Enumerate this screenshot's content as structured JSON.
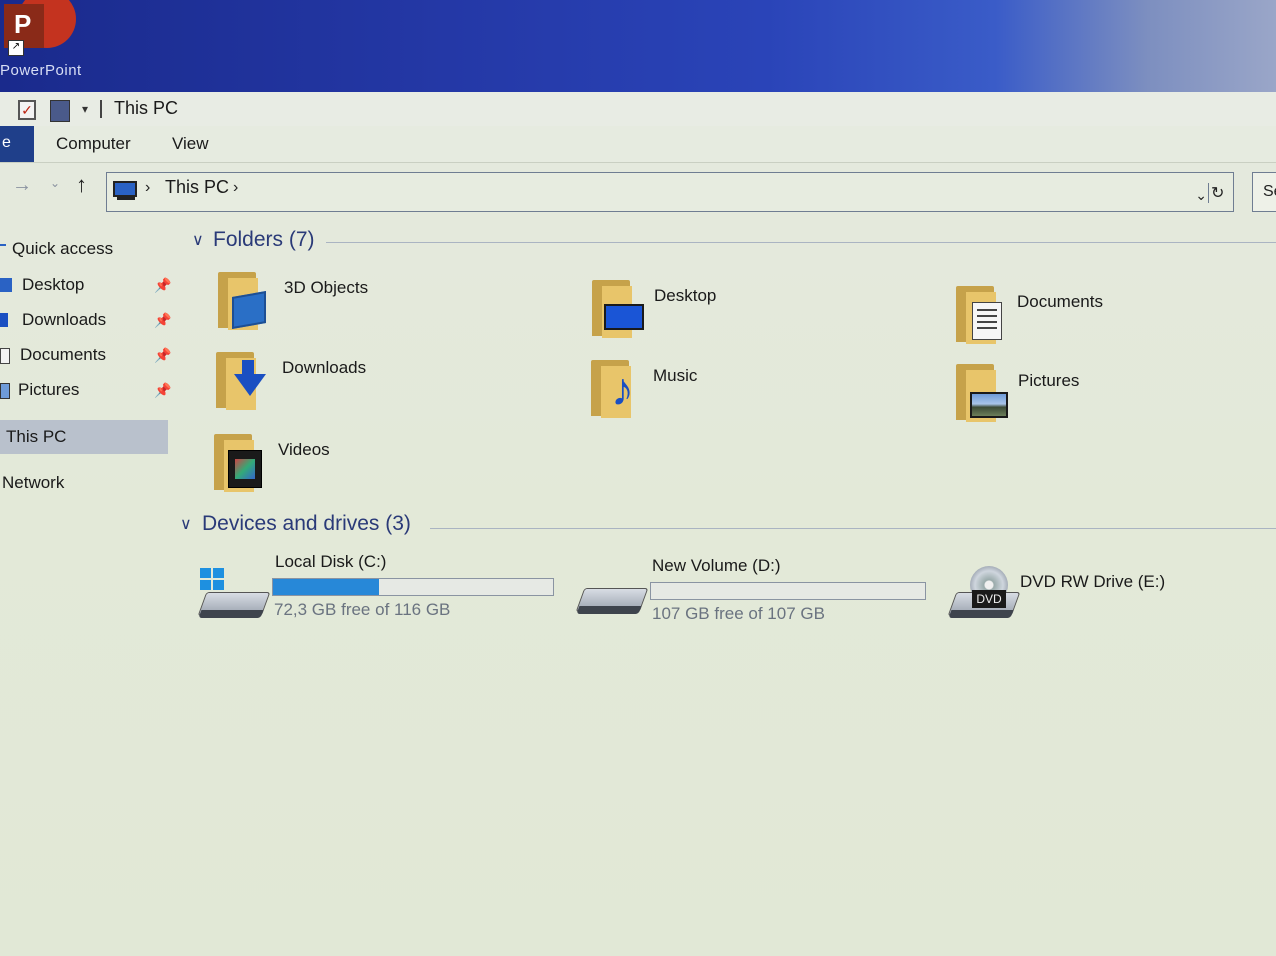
{
  "desktop": {
    "app_icon_letter": "P",
    "app_label": "PowerPoint"
  },
  "window": {
    "title": "This PC",
    "quick_access_dropdown": "▾",
    "ribbon": {
      "file_tab": "e",
      "tabs": [
        "Computer",
        "View"
      ]
    },
    "address": {
      "crumb_sep": "›",
      "crumb": "This PC",
      "refresh_icon": "↻",
      "dropdown_icon": "⌄",
      "search_partial": "Se"
    },
    "nav": {
      "forward": "→",
      "history": "⌄",
      "up": "↑"
    }
  },
  "sidebar": {
    "quick_access": "Quick access",
    "pin_glyph": "📌",
    "items": [
      {
        "label": "Desktop",
        "pinned": true
      },
      {
        "label": "Downloads",
        "pinned": true
      },
      {
        "label": "Documents",
        "pinned": true
      },
      {
        "label": "Pictures",
        "pinned": true
      }
    ],
    "this_pc": "This PC",
    "network": "Network"
  },
  "folders": {
    "header": "Folders (7)",
    "items": [
      {
        "label": "3D Objects",
        "icon": "3d-objects-icon"
      },
      {
        "label": "Desktop",
        "icon": "desktop-folder-icon"
      },
      {
        "label": "Documents",
        "icon": "documents-folder-icon"
      },
      {
        "label": "Downloads",
        "icon": "downloads-folder-icon"
      },
      {
        "label": "Music",
        "icon": "music-folder-icon"
      },
      {
        "label": "Pictures",
        "icon": "pictures-folder-icon"
      },
      {
        "label": "Videos",
        "icon": "videos-folder-icon"
      }
    ]
  },
  "drives": {
    "header": "Devices and drives (3)",
    "items": [
      {
        "name": "Local Disk (C:)",
        "free": "72,3 GB free of 116 GB",
        "used_fraction": 0.377
      },
      {
        "name": "New Volume (D:)",
        "free": "107 GB free of 107 GB",
        "used_fraction": 0.0
      },
      {
        "name": "DVD RW Drive (E:)",
        "badge": "DVD"
      }
    ]
  },
  "colors": {
    "accent": "#2788d8",
    "header_text": "#2a3a78",
    "selected": "#b9c1cc"
  }
}
